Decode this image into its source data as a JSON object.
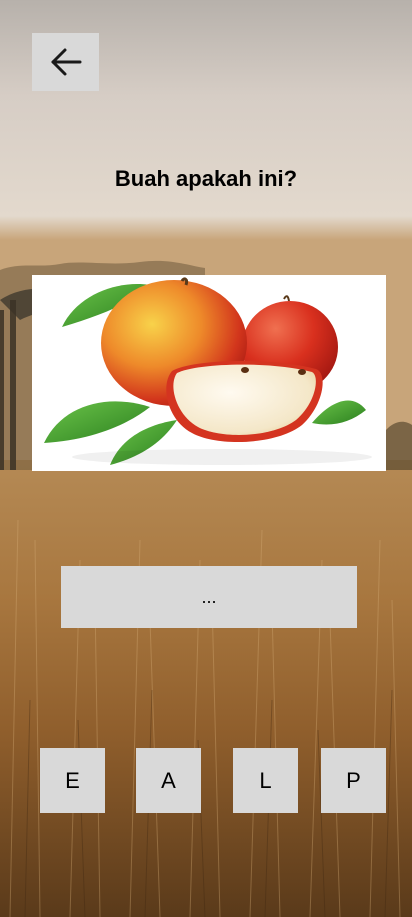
{
  "quiz": {
    "question": "Buah apakah ini?",
    "answer_placeholder": "...",
    "image_icon": "apple-image",
    "letters": [
      "E",
      "A",
      "L",
      "P"
    ]
  },
  "navigation": {
    "back_icon": "arrow-left-icon"
  },
  "colors": {
    "tile_background": "#d9d9d9",
    "text": "#000000"
  }
}
